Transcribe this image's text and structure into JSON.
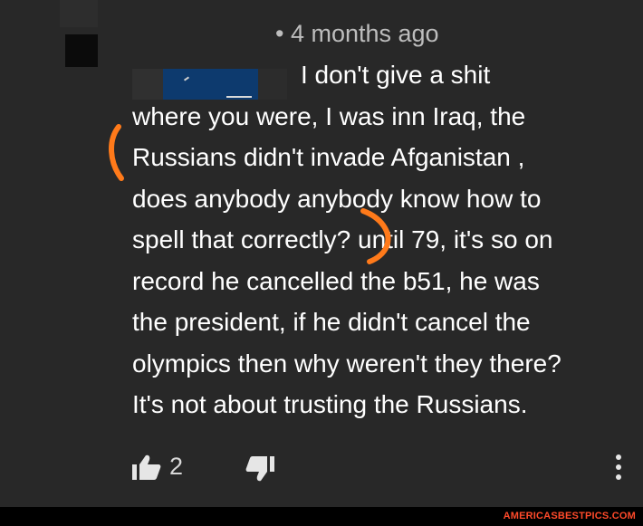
{
  "comment": {
    "timestamp": "• 4 months ago",
    "lines": [
      "I don't give a shit",
      "where you were, I was inn Iraq, the",
      "Russians didn't invade Afganistan ,",
      "does anybody anybody know how to",
      "spell that correctly? until 79, it's so on",
      "record he cancelled the b51, he was",
      "the president, if he didn't cancel the",
      "olympics then why weren't they there?",
      "It's not about trusting the Russians."
    ]
  },
  "actions": {
    "like_count": "2",
    "like_icon": "thumbs-up-icon",
    "dislike_icon": "thumbs-down-icon",
    "more_icon": "vertical-ellipsis-icon"
  },
  "watermark": {
    "text": "AMERICASBESTPICS.COM"
  },
  "colors": {
    "background": "#282828",
    "text": "#ffffff",
    "meta_text": "#bdbdbd",
    "annotation": "#ff7a1a",
    "watermark": "#ff4a2a"
  }
}
